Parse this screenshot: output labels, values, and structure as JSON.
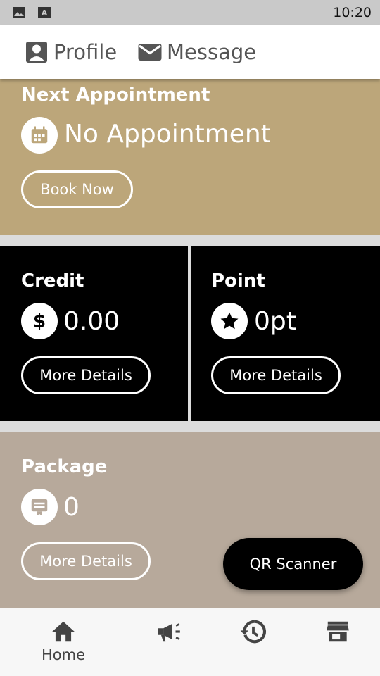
{
  "status_bar": {
    "time": "10:20",
    "icons": [
      "image-icon",
      "keyboard-a-icon"
    ]
  },
  "top_nav": {
    "profile_label": "Profile",
    "message_label": "Message"
  },
  "appointment": {
    "title": "Next Appointment",
    "value": "No Appointment",
    "button_label": "Book Now",
    "icon": "calendar-icon"
  },
  "credit": {
    "title": "Credit",
    "value": "0.00",
    "button_label": "More Details",
    "icon": "dollar-icon"
  },
  "point": {
    "title": "Point",
    "value": "0pt",
    "button_label": "More Details",
    "icon": "star-icon"
  },
  "package": {
    "title": "Package",
    "value": "0",
    "button_label": "More Details",
    "icon": "package-icon"
  },
  "fab": {
    "label": "QR Scanner"
  },
  "bottom_nav": {
    "items": [
      {
        "label": "Home",
        "icon": "home-icon",
        "active": true
      },
      {
        "label": "",
        "icon": "megaphone-icon",
        "active": false
      },
      {
        "label": "",
        "icon": "history-icon",
        "active": false
      },
      {
        "label": "",
        "icon": "store-icon",
        "active": false
      }
    ]
  },
  "colors": {
    "appointment_bg": "#bca67a",
    "credit_bg": "#000000",
    "package_bg": "#b7a99b",
    "nav_icon": "#555555"
  }
}
